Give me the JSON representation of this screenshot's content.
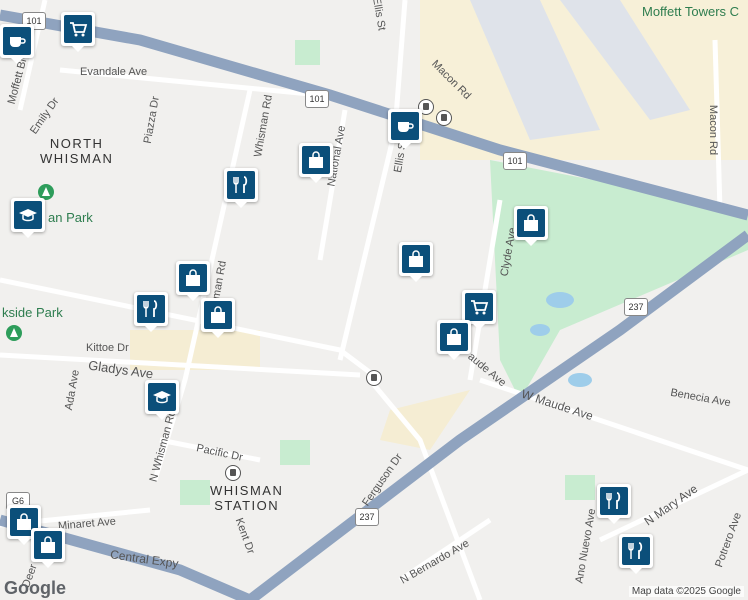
{
  "map": {
    "attribution": "Map data ©2025 Google",
    "logo_text": "Google",
    "areas": {
      "north_whisman": [
        "NORTH",
        "WHISMAN"
      ],
      "whisman_station": [
        "WHISMAN",
        "STATION"
      ]
    },
    "places": {
      "moffett_towers": "Moffett Towers C",
      "park_partial": "an Park",
      "kside_park": "kside Park"
    },
    "streets": {
      "evandale_ave": "Evandale Ave",
      "emily_dr": "Emily Dr",
      "piazza_dr": "Piazza Dr",
      "whisman_rd_top": "Whisman Rd",
      "national_ave": "National Ave",
      "ellis_st": "Ellis St",
      "ellis_top": "Ellis St",
      "macon_rd_diag": "Macon Rd",
      "macon_rd_right": "Macon Rd",
      "clyde_ave": "Clyde Ave",
      "kittoe_dr": "Kittoe Dr",
      "gladys_ave": "Gladys Ave",
      "ada_ave": "Ada Ave",
      "n_whisman_rd_mid": "Whisman Rd",
      "n_whisman_rd_low": "N Whisman Rd",
      "pacific_dr": "Pacific Dr",
      "minaret_ave": "Minaret Ave",
      "kent_dr": "Kent Dr",
      "central_expy": "Central Expy",
      "ferguson_dr": "Ferguson Dr",
      "n_bernardo_ave": "N Bernardo Ave",
      "ano_nuevo_ave": "Ano Nuevo Ave",
      "n_mary_ave": "N Mary Ave",
      "potrero_ave": "Potrero Ave",
      "benecia_ave": "Benecia Ave",
      "w_maude_ave": "W Maude Ave",
      "maude_ave_partial": "aude Ave",
      "moffett_blvd": "Moffett Blvd",
      "deer_partial": "Deer"
    },
    "highways": {
      "us101_a": "101",
      "us101_b": "101",
      "us101_c": "101",
      "ca237_a": "237",
      "ca237_b": "237",
      "g6": "G6"
    },
    "colors": {
      "land": "#f1f0ee",
      "park": "#c8ecd0",
      "airfield": "#f7f0d8",
      "freeway": "#8fa3bf",
      "marker": "#0b4f7a"
    },
    "markers": [
      {
        "type": "cafe-icon",
        "label": "cafe"
      },
      {
        "type": "grocery-icon",
        "label": "grocery"
      },
      {
        "type": "cafe-icon",
        "label": "cafe"
      },
      {
        "type": "shopping-icon",
        "label": "shopping"
      },
      {
        "type": "restaurant-icon",
        "label": "restaurant"
      },
      {
        "type": "school-icon",
        "label": "school"
      },
      {
        "type": "shopping-icon",
        "label": "shopping"
      },
      {
        "type": "shopping-icon",
        "label": "shopping"
      },
      {
        "type": "restaurant-icon",
        "label": "restaurant"
      },
      {
        "type": "shopping-icon",
        "label": "shopping"
      },
      {
        "type": "grocery-icon",
        "label": "grocery"
      },
      {
        "type": "shopping-icon",
        "label": "shopping"
      },
      {
        "type": "shopping-icon",
        "label": "shopping"
      },
      {
        "type": "school-icon",
        "label": "school"
      },
      {
        "type": "shopping-icon",
        "label": "shopping"
      },
      {
        "type": "shopping-icon",
        "label": "shopping"
      },
      {
        "type": "restaurant-icon",
        "label": "restaurant"
      },
      {
        "type": "restaurant-icon",
        "label": "restaurant"
      }
    ]
  }
}
